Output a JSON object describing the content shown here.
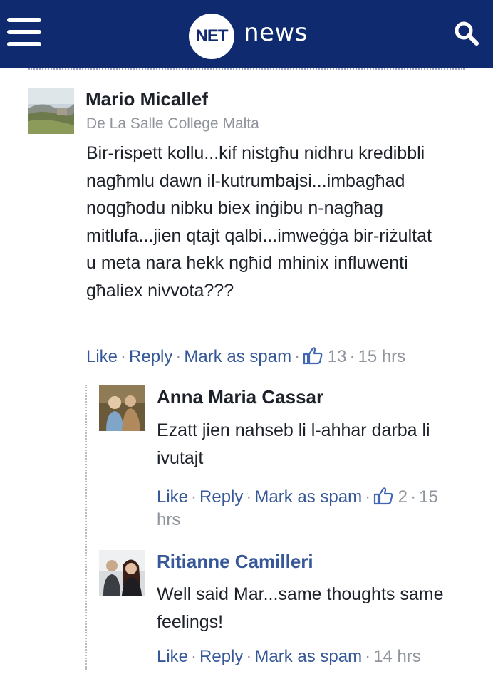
{
  "header": {
    "logo_text": "NET",
    "brand": "news",
    "menu_icon": "hamburger-icon",
    "search_icon": "search-icon",
    "bg_color": "#0f2a6e"
  },
  "comments": [
    {
      "author": "Mario Micallef",
      "affiliation": "De La Salle College Malta",
      "text": "Bir-rispett kollu...kif nistgħu nidhru kredibbli nagħmlu dawn il-kutrumbajsi...imbagħad noqgħodu nibku biex inġibu n-nagħag mitlufa...jien qtajt qalbi...imweġġa bir-riżultat u meta nara hekk ngħid mhinix influwenti għaliex nivvota???",
      "like": "Like",
      "reply": "Reply",
      "spam": "Mark as spam",
      "likes": "13",
      "time": "15 hrs"
    },
    {
      "author": "Anna Maria Cassar",
      "text": "Ezatt jien nahseb li l-ahhar darba li ivutajt",
      "like": "Like",
      "reply": "Reply",
      "spam": "Mark as spam",
      "likes": "2",
      "time": "15 hrs"
    },
    {
      "author": "Ritianne Camilleri",
      "text": "Well said Mar...same thoughts same feelings!",
      "like": "Like",
      "reply": "Reply",
      "spam": "Mark as spam",
      "time": "14 hrs"
    }
  ],
  "colors": {
    "link": "#365899",
    "meta": "#90949c",
    "text": "#1d2129"
  }
}
